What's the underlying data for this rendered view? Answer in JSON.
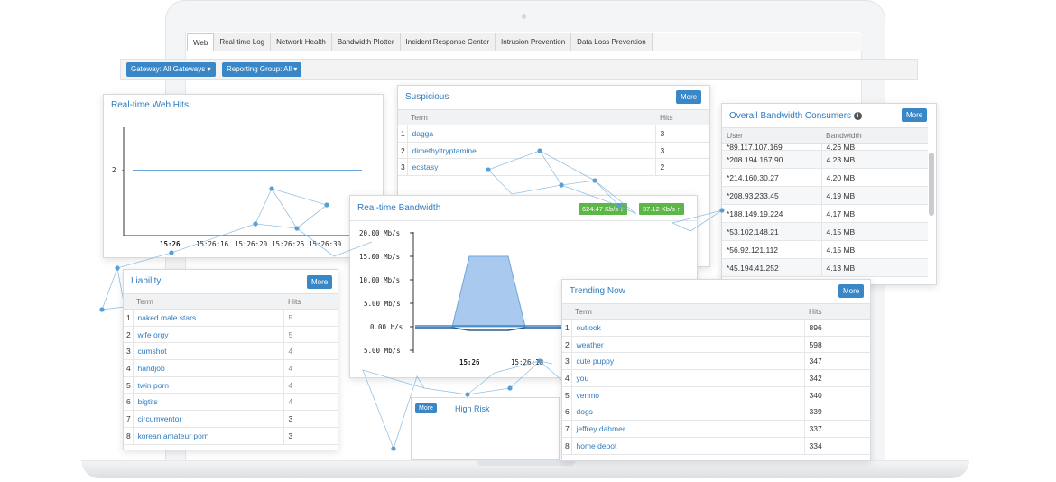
{
  "tabs": [
    "Web",
    "Real-time Log",
    "Network Health",
    "Bandwidth Plotter",
    "Incident Response Center",
    "Intrusion Prevention",
    "Data Loss Prevention"
  ],
  "filters": {
    "gateway": "Gateway: All Gateways ▾",
    "reporting_group": "Reporting Group: All ▾"
  },
  "more_label": "More",
  "web_hits": {
    "title": "Real-time Web Hits",
    "y_tick": "2",
    "x_ticks": [
      "15:26",
      "15:26:16",
      "15:26:20",
      "15:26:26",
      "15:26:30"
    ]
  },
  "suspicious": {
    "title": "Suspicious",
    "columns": [
      "Term",
      "Hits"
    ],
    "rows": [
      {
        "idx": "1",
        "term": "dagga",
        "hits": "3"
      },
      {
        "idx": "2",
        "term": "dimethyltryptamine",
        "hits": "3"
      },
      {
        "idx": "3",
        "term": "ecstasy",
        "hits": "2"
      }
    ]
  },
  "bandwidth_consumers": {
    "title": "Overall Bandwidth Consumers",
    "columns": [
      "User",
      "Bandwidth"
    ],
    "rows": [
      {
        "user": "*89.117.107.169",
        "bw": "4.26 MB"
      },
      {
        "user": "*208.194.167.90",
        "bw": "4.23 MB"
      },
      {
        "user": "*214.160.30.27",
        "bw": "4.20 MB"
      },
      {
        "user": "*208.93.233.45",
        "bw": "4.19 MB"
      },
      {
        "user": "*188.149.19.224",
        "bw": "4.17 MB"
      },
      {
        "user": "*53.102.148.21",
        "bw": "4.15 MB"
      },
      {
        "user": "*56.92.121.112",
        "bw": "4.15 MB"
      },
      {
        "user": "*45.194.41.252",
        "bw": "4.13 MB"
      }
    ]
  },
  "realtime_bandwidth": {
    "title": "Real-time Bandwidth",
    "down": "624.47 Kb/s ↓",
    "up": "37.12 Kb/s ↑",
    "y_ticks": [
      "20.00 Mb/s",
      "15.00 Mb/s",
      "10.00 Mb/s",
      "5.00 Mb/s",
      "0.00 b/s",
      "5.00 Mb/s"
    ],
    "x_ticks": [
      "15:26",
      "15:26:18"
    ]
  },
  "liability": {
    "title": "Liability",
    "columns": [
      "Term",
      "Hits"
    ],
    "rows": [
      {
        "idx": "1",
        "term": "naked male stars",
        "hits": "5"
      },
      {
        "idx": "2",
        "term": "wife orgy",
        "hits": "5"
      },
      {
        "idx": "3",
        "term": "cumshot",
        "hits": "4"
      },
      {
        "idx": "4",
        "term": "handjob",
        "hits": "4"
      },
      {
        "idx": "5",
        "term": "twin porn",
        "hits": "4"
      },
      {
        "idx": "6",
        "term": "bigtits",
        "hits": "4"
      },
      {
        "idx": "7",
        "term": "circumventor",
        "hits": "3"
      },
      {
        "idx": "8",
        "term": "korean amateur porn",
        "hits": "3"
      }
    ]
  },
  "trending": {
    "title": "Trending Now",
    "columns": [
      "Term",
      "Hits"
    ],
    "rows": [
      {
        "idx": "1",
        "term": "outlook",
        "hits": "896"
      },
      {
        "idx": "2",
        "term": "weather",
        "hits": "598"
      },
      {
        "idx": "3",
        "term": "cute puppy",
        "hits": "347"
      },
      {
        "idx": "4",
        "term": "you",
        "hits": "342"
      },
      {
        "idx": "5",
        "term": "venmo",
        "hits": "340"
      },
      {
        "idx": "6",
        "term": "dogs",
        "hits": "339"
      },
      {
        "idx": "7",
        "term": "jeffrey dahmer",
        "hits": "337"
      },
      {
        "idx": "8",
        "term": "home depot",
        "hits": "334"
      }
    ]
  },
  "high_risk": {
    "title": "High Risk"
  },
  "colors": {
    "accent": "#3a87c8",
    "link": "#2f7bbf",
    "badge_green": "#5db648",
    "network": "#5a9fd4"
  }
}
